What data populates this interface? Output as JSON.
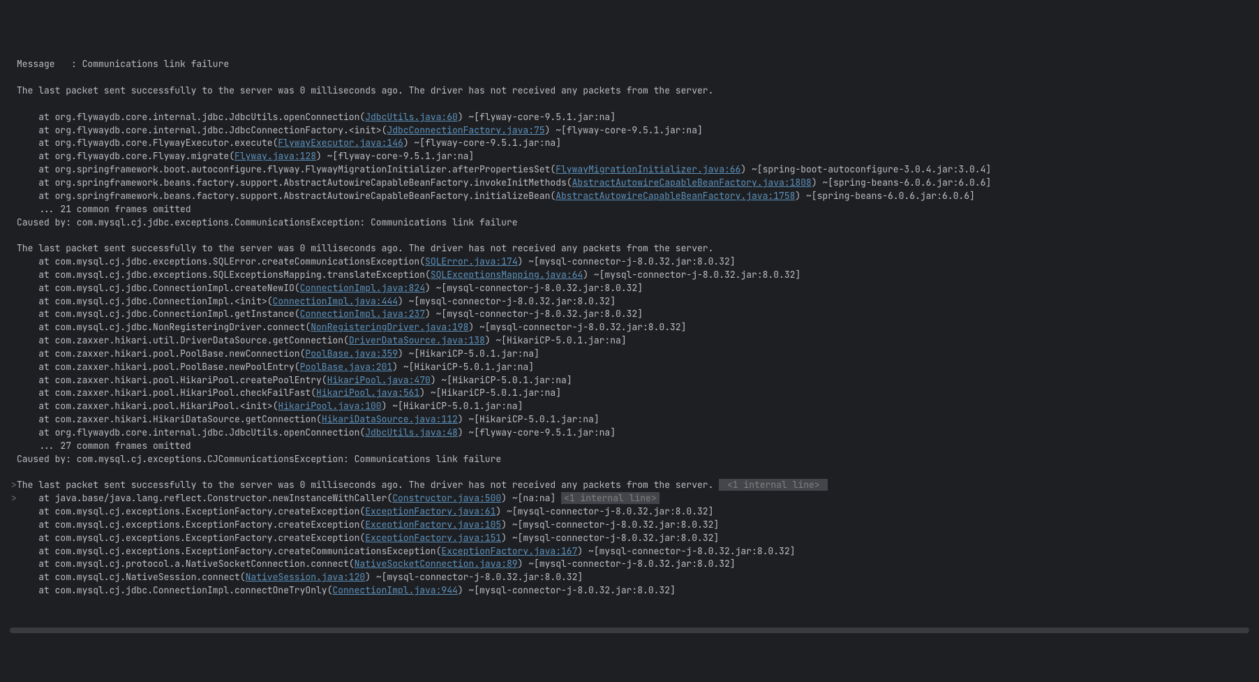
{
  "header1": "Message   : Communications link failure",
  "blank": "",
  "packet_msg": "The last packet sent successfully to the server was 0 milliseconds ago. The driver has not received any packets from the server.",
  "frames1": [
    {
      "pre": "    at org.flywaydb.core.internal.jdbc.JdbcUtils.openConnection(",
      "link": "JdbcUtils.java:60",
      "post": ") ~[flyway-core-9.5.1.jar:na]"
    },
    {
      "pre": "    at org.flywaydb.core.internal.jdbc.JdbcConnectionFactory.<init>(",
      "link": "JdbcConnectionFactory.java:75",
      "post": ") ~[flyway-core-9.5.1.jar:na]"
    },
    {
      "pre": "    at org.flywaydb.core.FlywayExecutor.execute(",
      "link": "FlywayExecutor.java:146",
      "post": ") ~[flyway-core-9.5.1.jar:na]"
    },
    {
      "pre": "    at org.flywaydb.core.Flyway.migrate(",
      "link": "Flyway.java:128",
      "post": ") ~[flyway-core-9.5.1.jar:na]"
    },
    {
      "pre": "    at org.springframework.boot.autoconfigure.flyway.FlywayMigrationInitializer.afterPropertiesSet(",
      "link": "FlywayMigrationInitializer.java:66",
      "post": ") ~[spring-boot-autoconfigure-3.0.4.jar:3.0.4]"
    },
    {
      "pre": "    at org.springframework.beans.factory.support.AbstractAutowireCapableBeanFactory.invokeInitMethods(",
      "link": "AbstractAutowireCapableBeanFactory.java:1808",
      "post": ") ~[spring-beans-6.0.6.jar:6.0.6]"
    },
    {
      "pre": "    at org.springframework.beans.factory.support.AbstractAutowireCapableBeanFactory.initializeBean(",
      "link": "AbstractAutowireCapableBeanFactory.java:1758",
      "post": ") ~[spring-beans-6.0.6.jar:6.0.6]"
    }
  ],
  "omit1": "    ... 21 common frames omitted",
  "caused1": "Caused by: com.mysql.cj.jdbc.exceptions.CommunicationsException: Communications link failure",
  "frames2": [
    {
      "pre": "    at com.mysql.cj.jdbc.exceptions.SQLError.createCommunicationsException(",
      "link": "SQLError.java:174",
      "post": ") ~[mysql-connector-j-8.0.32.jar:8.0.32]"
    },
    {
      "pre": "    at com.mysql.cj.jdbc.exceptions.SQLExceptionsMapping.translateException(",
      "link": "SQLExceptionsMapping.java:64",
      "post": ") ~[mysql-connector-j-8.0.32.jar:8.0.32]"
    },
    {
      "pre": "    at com.mysql.cj.jdbc.ConnectionImpl.createNewIO(",
      "link": "ConnectionImpl.java:824",
      "post": ") ~[mysql-connector-j-8.0.32.jar:8.0.32]"
    },
    {
      "pre": "    at com.mysql.cj.jdbc.ConnectionImpl.<init>(",
      "link": "ConnectionImpl.java:444",
      "post": ") ~[mysql-connector-j-8.0.32.jar:8.0.32]"
    },
    {
      "pre": "    at com.mysql.cj.jdbc.ConnectionImpl.getInstance(",
      "link": "ConnectionImpl.java:237",
      "post": ") ~[mysql-connector-j-8.0.32.jar:8.0.32]"
    },
    {
      "pre": "    at com.mysql.cj.jdbc.NonRegisteringDriver.connect(",
      "link": "NonRegisteringDriver.java:198",
      "post": ") ~[mysql-connector-j-8.0.32.jar:8.0.32]"
    },
    {
      "pre": "    at com.zaxxer.hikari.util.DriverDataSource.getConnection(",
      "link": "DriverDataSource.java:138",
      "post": ") ~[HikariCP-5.0.1.jar:na]"
    },
    {
      "pre": "    at com.zaxxer.hikari.pool.PoolBase.newConnection(",
      "link": "PoolBase.java:359",
      "post": ") ~[HikariCP-5.0.1.jar:na]"
    },
    {
      "pre": "    at com.zaxxer.hikari.pool.PoolBase.newPoolEntry(",
      "link": "PoolBase.java:201",
      "post": ") ~[HikariCP-5.0.1.jar:na]"
    },
    {
      "pre": "    at com.zaxxer.hikari.pool.HikariPool.createPoolEntry(",
      "link": "HikariPool.java:470",
      "post": ") ~[HikariCP-5.0.1.jar:na]"
    },
    {
      "pre": "    at com.zaxxer.hikari.pool.HikariPool.checkFailFast(",
      "link": "HikariPool.java:561",
      "post": ") ~[HikariCP-5.0.1.jar:na]"
    },
    {
      "pre": "    at com.zaxxer.hikari.pool.HikariPool.<init>(",
      "link": "HikariPool.java:100",
      "post": ") ~[HikariCP-5.0.1.jar:na]"
    },
    {
      "pre": "    at com.zaxxer.hikari.HikariDataSource.getConnection(",
      "link": "HikariDataSource.java:112",
      "post": ") ~[HikariCP-5.0.1.jar:na]"
    },
    {
      "pre": "    at org.flywaydb.core.internal.jdbc.JdbcUtils.openConnection(",
      "link": "JdbcUtils.java:48",
      "post": ") ~[flyway-core-9.5.1.jar:na]"
    }
  ],
  "omit2": "    ... 27 common frames omitted",
  "caused2": "Caused by: com.mysql.cj.exceptions.CJCommunicationsException: Communications link failure",
  "internal_line": " <1 internal line> ",
  "internal_line2": "<1 internal line>",
  "frame_constructor": {
    "pre": "    at java.base/java.lang.reflect.Constructor.newInstanceWithCaller(",
    "link": "Constructor.java:500",
    "post": ") ~[na:na] "
  },
  "frames3": [
    {
      "pre": "    at com.mysql.cj.exceptions.ExceptionFactory.createException(",
      "link": "ExceptionFactory.java:61",
      "post": ") ~[mysql-connector-j-8.0.32.jar:8.0.32]"
    },
    {
      "pre": "    at com.mysql.cj.exceptions.ExceptionFactory.createException(",
      "link": "ExceptionFactory.java:105",
      "post": ") ~[mysql-connector-j-8.0.32.jar:8.0.32]"
    },
    {
      "pre": "    at com.mysql.cj.exceptions.ExceptionFactory.createException(",
      "link": "ExceptionFactory.java:151",
      "post": ") ~[mysql-connector-j-8.0.32.jar:8.0.32]"
    },
    {
      "pre": "    at com.mysql.cj.exceptions.ExceptionFactory.createCommunicationsException(",
      "link": "ExceptionFactory.java:167",
      "post": ") ~[mysql-connector-j-8.0.32.jar:8.0.32]"
    },
    {
      "pre": "    at com.mysql.cj.protocol.a.NativeSocketConnection.connect(",
      "link": "NativeSocketConnection.java:89",
      "post": ") ~[mysql-connector-j-8.0.32.jar:8.0.32]"
    },
    {
      "pre": "    at com.mysql.cj.NativeSession.connect(",
      "link": "NativeSession.java:120",
      "post": ") ~[mysql-connector-j-8.0.32.jar:8.0.32]"
    },
    {
      "pre": "    at com.mysql.cj.jdbc.ConnectionImpl.connectOneTryOnly(",
      "link": "ConnectionImpl.java:944",
      "post": ") ~[mysql-connector-j-8.0.32.jar:8.0.32]"
    }
  ],
  "gutter_chevron": ">"
}
